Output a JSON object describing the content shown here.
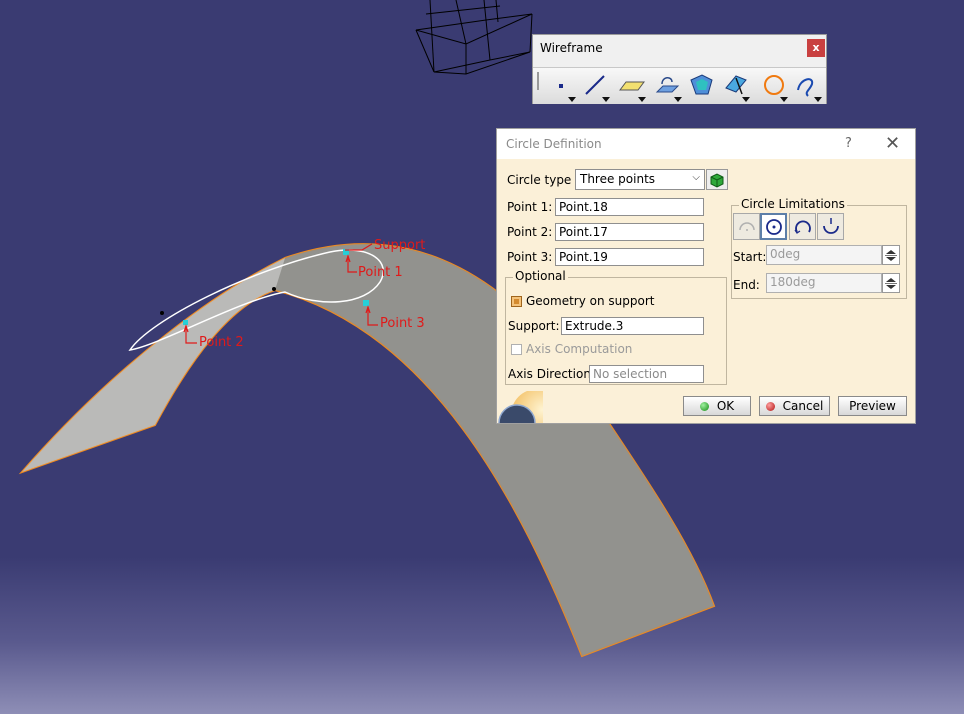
{
  "viewport": {
    "labels": {
      "support": "Support",
      "point1": "Point 1",
      "point2": "Point 2",
      "point3": "Point 3"
    },
    "colors": {
      "background": "#3a3b72",
      "surface": "#9a9a94",
      "surface_edge": "#f08a1e",
      "annotation": "#e01a1a",
      "point_marker": "#25d0d8"
    }
  },
  "toolbar": {
    "title": "Wireframe",
    "close_label": "x",
    "tools": [
      {
        "name": "point-icon",
        "has_dropdown": true
      },
      {
        "name": "line-icon",
        "has_dropdown": true
      },
      {
        "name": "plane-icon",
        "has_dropdown": true
      },
      {
        "name": "projection-icon",
        "has_dropdown": true
      },
      {
        "name": "offset-icon",
        "has_dropdown": false
      },
      {
        "name": "intersection-icon",
        "has_dropdown": true
      },
      {
        "name": "circle-icon",
        "has_dropdown": true
      },
      {
        "name": "spline-icon",
        "has_dropdown": true
      }
    ]
  },
  "dialog": {
    "title": "Circle Definition",
    "help": "?",
    "close": "✕",
    "circle_type_label": "Circle type :",
    "circle_type_value": "Three points",
    "point1_label": "Point 1:",
    "point1_value": "Point.18",
    "point2_label": "Point 2:",
    "point2_value": "Point.17",
    "point3_label": "Point 3:",
    "point3_value": "Point.19",
    "optional": {
      "title": "Optional",
      "geometry_on_support": {
        "label": "Geometry on support",
        "checked": true
      },
      "support_label": "Support:",
      "support_value": "Extrude.3",
      "axis_computation": {
        "label": "Axis Computation",
        "checked": false,
        "enabled": false
      },
      "axis_direction_label": "Axis Direction:",
      "axis_direction_value": "No selection"
    },
    "limitations": {
      "title": "Circle Limitations",
      "start_label": "Start:",
      "start_value": "0deg",
      "end_label": "End:",
      "end_value": "180deg"
    },
    "buttons": {
      "ok": "OK",
      "cancel": "Cancel",
      "preview": "Preview"
    }
  }
}
